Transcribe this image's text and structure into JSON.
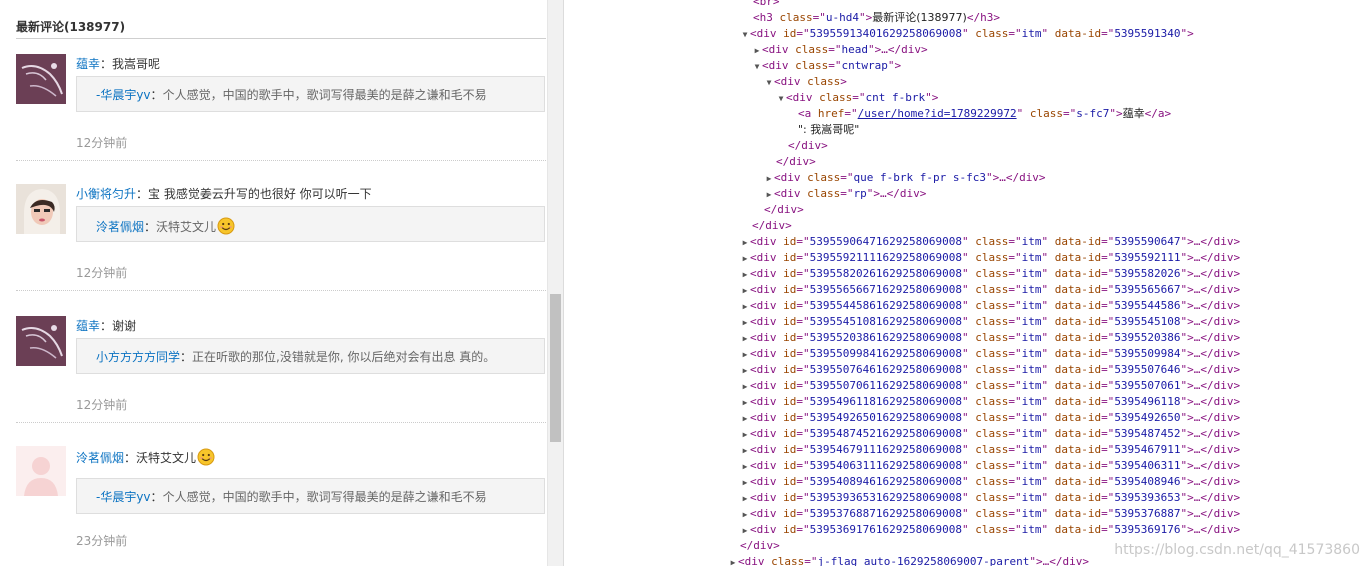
{
  "left": {
    "section_title": "最新评论(138977)",
    "comments": [
      {
        "avatar": "avatar-purple",
        "user": "蕴幸",
        "sep": "：",
        "text": "我嵩哥呢",
        "reply": {
          "user": "-华晨宇yv",
          "sep": "：",
          "text": "个人感觉，中国的歌手中，歌词写得最美的是薛之谦和毛不易"
        },
        "time": "12分钟前"
      },
      {
        "avatar": "avatar-photo",
        "user": "小衡将匀升",
        "sep": "：",
        "text": "宝 我感觉姜云升写的也很好 你可以听一下",
        "reply": {
          "user": "泠茗佩烟",
          "sep": "：",
          "text": "沃特艾文儿",
          "emoji": "smile-emoji"
        },
        "time": "12分钟前"
      },
      {
        "avatar": "avatar-purple",
        "user": "蕴幸",
        "sep": "：",
        "text": "谢谢",
        "reply": {
          "user": "小方方方方同学",
          "sep": "：",
          "text": "正在听歌的那位,没错就是你, 你以后绝对会有出息 真的。"
        },
        "time": "12分钟前"
      },
      {
        "avatar": "avatar-default",
        "user": "泠茗佩烟",
        "sep": "：",
        "text": "沃特艾文儿",
        "emoji": "smile-emoji",
        "reply": {
          "user": "-华晨宇yv",
          "sep": "：",
          "text": "个人感觉，中国的歌手中，歌词写得最美的是薛之谦和毛不易"
        },
        "time": "23分钟前"
      }
    ]
  },
  "devtools": {
    "br": "<br>",
    "h3": {
      "open": "<h3",
      "attr": "class",
      "eq": "=\"",
      "val": "u-hd4",
      "close": "\">",
      "text": "最新评论(138977)",
      "end": "</h3>"
    },
    "open_item": {
      "id": "539559134016292580690​08",
      "data_id": "5395591340"
    },
    "head": {
      "cls": "head"
    },
    "cntwrap": {
      "cls": "cntwrap"
    },
    "div_class": "<div class>",
    "cnt": {
      "cls": "cnt f-brk"
    },
    "anchor": {
      "href": "/user/home?id=1789229972",
      "cls": "s-fc7",
      "text": "蕴幸"
    },
    "anchor_text": "\": 我嵩哥呢\"",
    "close_div": "</div>",
    "que": {
      "cls": "que f-brk f-pr s-fc3"
    },
    "rp": {
      "cls": "rp"
    },
    "items": [
      {
        "id": "53955906471629258069008",
        "data_id": "5395590647"
      },
      {
        "id": "53955921111629258069008",
        "data_id": "5395592111"
      },
      {
        "id": "53955820261629258069008",
        "data_id": "5395582026"
      },
      {
        "id": "53955656671629258069008",
        "data_id": "5395565667"
      },
      {
        "id": "53955445861629258069008",
        "data_id": "5395544586"
      },
      {
        "id": "53955451081629258069008",
        "data_id": "5395545108"
      },
      {
        "id": "53955203861629258069008",
        "data_id": "5395520386"
      },
      {
        "id": "53955099841629258069008",
        "data_id": "5395509984"
      },
      {
        "id": "53955076461629258069008",
        "data_id": "5395507646"
      },
      {
        "id": "53955070611629258069008",
        "data_id": "5395507061"
      },
      {
        "id": "53954961181629258069008",
        "data_id": "5395496118"
      },
      {
        "id": "53954926501629258069008",
        "data_id": "5395492650"
      },
      {
        "id": "53954874521629258069008",
        "data_id": "5395487452"
      },
      {
        "id": "53954679111629258069008",
        "data_id": "5395467911"
      },
      {
        "id": "53954063111629258069008",
        "data_id": "5395406311"
      },
      {
        "id": "53954089461629258069008",
        "data_id": "5395408946"
      },
      {
        "id": "53953936531629258069008",
        "data_id": "5395393653"
      },
      {
        "id": "53953768871629258069008",
        "data_id": "5395376887"
      },
      {
        "id": "53953691761629258069008",
        "data_id": "5395369176"
      }
    ],
    "last_close": "</div>",
    "flag": {
      "cls": "j-flag auto-1629258069007-parent"
    },
    "watermark": "https://blog.csdn.net/qq_41573860"
  }
}
